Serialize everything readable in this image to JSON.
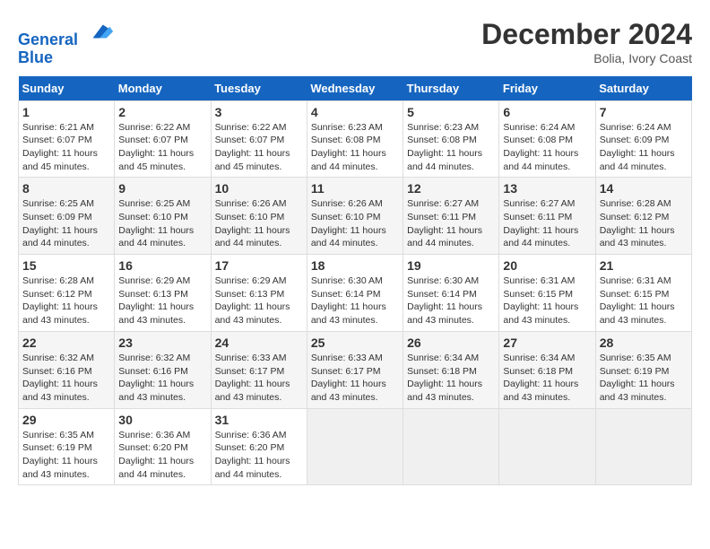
{
  "header": {
    "logo_line1": "General",
    "logo_line2": "Blue",
    "month_title": "December 2024",
    "location": "Bolia, Ivory Coast"
  },
  "weekdays": [
    "Sunday",
    "Monday",
    "Tuesday",
    "Wednesday",
    "Thursday",
    "Friday",
    "Saturday"
  ],
  "weeks": [
    [
      {
        "day": 1,
        "info": "Sunrise: 6:21 AM\nSunset: 6:07 PM\nDaylight: 11 hours\nand 45 minutes."
      },
      {
        "day": 2,
        "info": "Sunrise: 6:22 AM\nSunset: 6:07 PM\nDaylight: 11 hours\nand 45 minutes."
      },
      {
        "day": 3,
        "info": "Sunrise: 6:22 AM\nSunset: 6:07 PM\nDaylight: 11 hours\nand 45 minutes."
      },
      {
        "day": 4,
        "info": "Sunrise: 6:23 AM\nSunset: 6:08 PM\nDaylight: 11 hours\nand 44 minutes."
      },
      {
        "day": 5,
        "info": "Sunrise: 6:23 AM\nSunset: 6:08 PM\nDaylight: 11 hours\nand 44 minutes."
      },
      {
        "day": 6,
        "info": "Sunrise: 6:24 AM\nSunset: 6:08 PM\nDaylight: 11 hours\nand 44 minutes."
      },
      {
        "day": 7,
        "info": "Sunrise: 6:24 AM\nSunset: 6:09 PM\nDaylight: 11 hours\nand 44 minutes."
      }
    ],
    [
      {
        "day": 8,
        "info": "Sunrise: 6:25 AM\nSunset: 6:09 PM\nDaylight: 11 hours\nand 44 minutes."
      },
      {
        "day": 9,
        "info": "Sunrise: 6:25 AM\nSunset: 6:10 PM\nDaylight: 11 hours\nand 44 minutes."
      },
      {
        "day": 10,
        "info": "Sunrise: 6:26 AM\nSunset: 6:10 PM\nDaylight: 11 hours\nand 44 minutes."
      },
      {
        "day": 11,
        "info": "Sunrise: 6:26 AM\nSunset: 6:10 PM\nDaylight: 11 hours\nand 44 minutes."
      },
      {
        "day": 12,
        "info": "Sunrise: 6:27 AM\nSunset: 6:11 PM\nDaylight: 11 hours\nand 44 minutes."
      },
      {
        "day": 13,
        "info": "Sunrise: 6:27 AM\nSunset: 6:11 PM\nDaylight: 11 hours\nand 44 minutes."
      },
      {
        "day": 14,
        "info": "Sunrise: 6:28 AM\nSunset: 6:12 PM\nDaylight: 11 hours\nand 43 minutes."
      }
    ],
    [
      {
        "day": 15,
        "info": "Sunrise: 6:28 AM\nSunset: 6:12 PM\nDaylight: 11 hours\nand 43 minutes."
      },
      {
        "day": 16,
        "info": "Sunrise: 6:29 AM\nSunset: 6:13 PM\nDaylight: 11 hours\nand 43 minutes."
      },
      {
        "day": 17,
        "info": "Sunrise: 6:29 AM\nSunset: 6:13 PM\nDaylight: 11 hours\nand 43 minutes."
      },
      {
        "day": 18,
        "info": "Sunrise: 6:30 AM\nSunset: 6:14 PM\nDaylight: 11 hours\nand 43 minutes."
      },
      {
        "day": 19,
        "info": "Sunrise: 6:30 AM\nSunset: 6:14 PM\nDaylight: 11 hours\nand 43 minutes."
      },
      {
        "day": 20,
        "info": "Sunrise: 6:31 AM\nSunset: 6:15 PM\nDaylight: 11 hours\nand 43 minutes."
      },
      {
        "day": 21,
        "info": "Sunrise: 6:31 AM\nSunset: 6:15 PM\nDaylight: 11 hours\nand 43 minutes."
      }
    ],
    [
      {
        "day": 22,
        "info": "Sunrise: 6:32 AM\nSunset: 6:16 PM\nDaylight: 11 hours\nand 43 minutes."
      },
      {
        "day": 23,
        "info": "Sunrise: 6:32 AM\nSunset: 6:16 PM\nDaylight: 11 hours\nand 43 minutes."
      },
      {
        "day": 24,
        "info": "Sunrise: 6:33 AM\nSunset: 6:17 PM\nDaylight: 11 hours\nand 43 minutes."
      },
      {
        "day": 25,
        "info": "Sunrise: 6:33 AM\nSunset: 6:17 PM\nDaylight: 11 hours\nand 43 minutes."
      },
      {
        "day": 26,
        "info": "Sunrise: 6:34 AM\nSunset: 6:18 PM\nDaylight: 11 hours\nand 43 minutes."
      },
      {
        "day": 27,
        "info": "Sunrise: 6:34 AM\nSunset: 6:18 PM\nDaylight: 11 hours\nand 43 minutes."
      },
      {
        "day": 28,
        "info": "Sunrise: 6:35 AM\nSunset: 6:19 PM\nDaylight: 11 hours\nand 43 minutes."
      }
    ],
    [
      {
        "day": 29,
        "info": "Sunrise: 6:35 AM\nSunset: 6:19 PM\nDaylight: 11 hours\nand 43 minutes."
      },
      {
        "day": 30,
        "info": "Sunrise: 6:36 AM\nSunset: 6:20 PM\nDaylight: 11 hours\nand 44 minutes."
      },
      {
        "day": 31,
        "info": "Sunrise: 6:36 AM\nSunset: 6:20 PM\nDaylight: 11 hours\nand 44 minutes."
      },
      null,
      null,
      null,
      null
    ]
  ]
}
